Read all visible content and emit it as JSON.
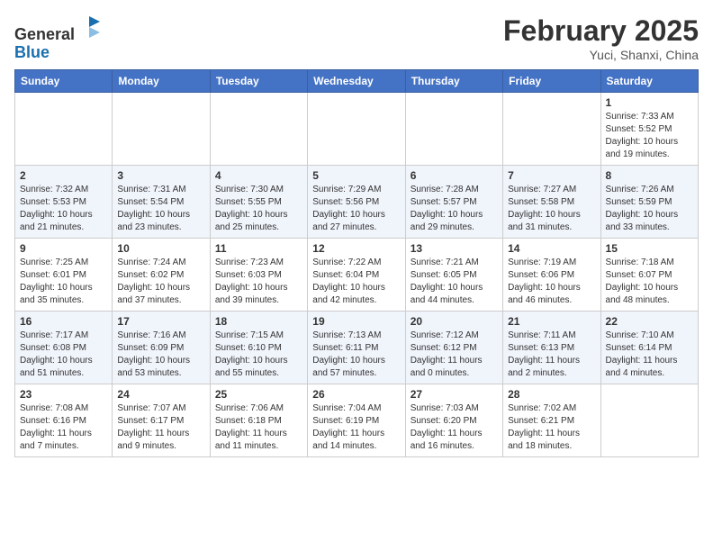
{
  "header": {
    "logo_line1": "General",
    "logo_line2": "Blue",
    "month_title": "February 2025",
    "subtitle": "Yuci, Shanxi, China"
  },
  "weekdays": [
    "Sunday",
    "Monday",
    "Tuesday",
    "Wednesday",
    "Thursday",
    "Friday",
    "Saturday"
  ],
  "weeks": [
    [
      {
        "day": "",
        "info": ""
      },
      {
        "day": "",
        "info": ""
      },
      {
        "day": "",
        "info": ""
      },
      {
        "day": "",
        "info": ""
      },
      {
        "day": "",
        "info": ""
      },
      {
        "day": "",
        "info": ""
      },
      {
        "day": "1",
        "info": "Sunrise: 7:33 AM\nSunset: 5:52 PM\nDaylight: 10 hours and 19 minutes."
      }
    ],
    [
      {
        "day": "2",
        "info": "Sunrise: 7:32 AM\nSunset: 5:53 PM\nDaylight: 10 hours and 21 minutes."
      },
      {
        "day": "3",
        "info": "Sunrise: 7:31 AM\nSunset: 5:54 PM\nDaylight: 10 hours and 23 minutes."
      },
      {
        "day": "4",
        "info": "Sunrise: 7:30 AM\nSunset: 5:55 PM\nDaylight: 10 hours and 25 minutes."
      },
      {
        "day": "5",
        "info": "Sunrise: 7:29 AM\nSunset: 5:56 PM\nDaylight: 10 hours and 27 minutes."
      },
      {
        "day": "6",
        "info": "Sunrise: 7:28 AM\nSunset: 5:57 PM\nDaylight: 10 hours and 29 minutes."
      },
      {
        "day": "7",
        "info": "Sunrise: 7:27 AM\nSunset: 5:58 PM\nDaylight: 10 hours and 31 minutes."
      },
      {
        "day": "8",
        "info": "Sunrise: 7:26 AM\nSunset: 5:59 PM\nDaylight: 10 hours and 33 minutes."
      }
    ],
    [
      {
        "day": "9",
        "info": "Sunrise: 7:25 AM\nSunset: 6:01 PM\nDaylight: 10 hours and 35 minutes."
      },
      {
        "day": "10",
        "info": "Sunrise: 7:24 AM\nSunset: 6:02 PM\nDaylight: 10 hours and 37 minutes."
      },
      {
        "day": "11",
        "info": "Sunrise: 7:23 AM\nSunset: 6:03 PM\nDaylight: 10 hours and 39 minutes."
      },
      {
        "day": "12",
        "info": "Sunrise: 7:22 AM\nSunset: 6:04 PM\nDaylight: 10 hours and 42 minutes."
      },
      {
        "day": "13",
        "info": "Sunrise: 7:21 AM\nSunset: 6:05 PM\nDaylight: 10 hours and 44 minutes."
      },
      {
        "day": "14",
        "info": "Sunrise: 7:19 AM\nSunset: 6:06 PM\nDaylight: 10 hours and 46 minutes."
      },
      {
        "day": "15",
        "info": "Sunrise: 7:18 AM\nSunset: 6:07 PM\nDaylight: 10 hours and 48 minutes."
      }
    ],
    [
      {
        "day": "16",
        "info": "Sunrise: 7:17 AM\nSunset: 6:08 PM\nDaylight: 10 hours and 51 minutes."
      },
      {
        "day": "17",
        "info": "Sunrise: 7:16 AM\nSunset: 6:09 PM\nDaylight: 10 hours and 53 minutes."
      },
      {
        "day": "18",
        "info": "Sunrise: 7:15 AM\nSunset: 6:10 PM\nDaylight: 10 hours and 55 minutes."
      },
      {
        "day": "19",
        "info": "Sunrise: 7:13 AM\nSunset: 6:11 PM\nDaylight: 10 hours and 57 minutes."
      },
      {
        "day": "20",
        "info": "Sunrise: 7:12 AM\nSunset: 6:12 PM\nDaylight: 11 hours and 0 minutes."
      },
      {
        "day": "21",
        "info": "Sunrise: 7:11 AM\nSunset: 6:13 PM\nDaylight: 11 hours and 2 minutes."
      },
      {
        "day": "22",
        "info": "Sunrise: 7:10 AM\nSunset: 6:14 PM\nDaylight: 11 hours and 4 minutes."
      }
    ],
    [
      {
        "day": "23",
        "info": "Sunrise: 7:08 AM\nSunset: 6:16 PM\nDaylight: 11 hours and 7 minutes."
      },
      {
        "day": "24",
        "info": "Sunrise: 7:07 AM\nSunset: 6:17 PM\nDaylight: 11 hours and 9 minutes."
      },
      {
        "day": "25",
        "info": "Sunrise: 7:06 AM\nSunset: 6:18 PM\nDaylight: 11 hours and 11 minutes."
      },
      {
        "day": "26",
        "info": "Sunrise: 7:04 AM\nSunset: 6:19 PM\nDaylight: 11 hours and 14 minutes."
      },
      {
        "day": "27",
        "info": "Sunrise: 7:03 AM\nSunset: 6:20 PM\nDaylight: 11 hours and 16 minutes."
      },
      {
        "day": "28",
        "info": "Sunrise: 7:02 AM\nSunset: 6:21 PM\nDaylight: 11 hours and 18 minutes."
      },
      {
        "day": "",
        "info": ""
      }
    ]
  ]
}
